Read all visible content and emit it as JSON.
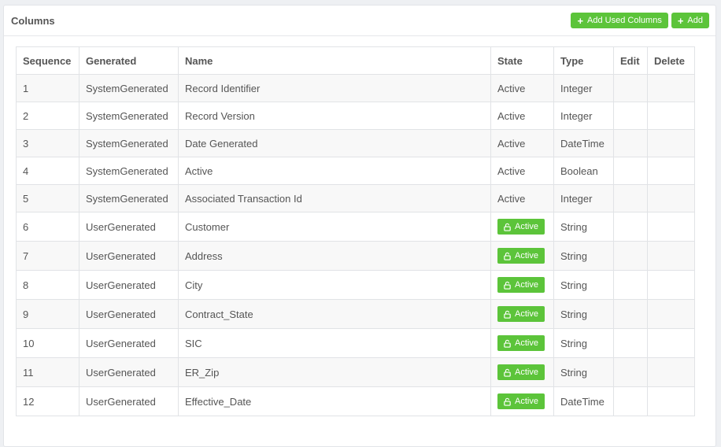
{
  "panel": {
    "title": "Columns",
    "add_used_columns_label": "Add Used Columns",
    "add_label": "Add"
  },
  "table": {
    "headers": [
      "Sequence",
      "Generated",
      "Name",
      "State",
      "Type",
      "Edit",
      "Delete"
    ],
    "rows": [
      {
        "seq": "1",
        "generated": "SystemGenerated",
        "name": "Record Identifier",
        "state": "Active",
        "badge": false,
        "type": "Integer"
      },
      {
        "seq": "2",
        "generated": "SystemGenerated",
        "name": "Record Version",
        "state": "Active",
        "badge": false,
        "type": "Integer"
      },
      {
        "seq": "3",
        "generated": "SystemGenerated",
        "name": "Date Generated",
        "state": "Active",
        "badge": false,
        "type": "DateTime"
      },
      {
        "seq": "4",
        "generated": "SystemGenerated",
        "name": "Active",
        "state": "Active",
        "badge": false,
        "type": "Boolean"
      },
      {
        "seq": "5",
        "generated": "SystemGenerated",
        "name": "Associated Transaction Id",
        "state": "Active",
        "badge": false,
        "type": "Integer"
      },
      {
        "seq": "6",
        "generated": "UserGenerated",
        "name": "Customer",
        "state": "Active",
        "badge": true,
        "type": "String"
      },
      {
        "seq": "7",
        "generated": "UserGenerated",
        "name": "Address",
        "state": "Active",
        "badge": true,
        "type": "String"
      },
      {
        "seq": "8",
        "generated": "UserGenerated",
        "name": "City",
        "state": "Active",
        "badge": true,
        "type": "String"
      },
      {
        "seq": "9",
        "generated": "UserGenerated",
        "name": "Contract_State",
        "state": "Active",
        "badge": true,
        "type": "String"
      },
      {
        "seq": "10",
        "generated": "UserGenerated",
        "name": "SIC",
        "state": "Active",
        "badge": true,
        "type": "String"
      },
      {
        "seq": "11",
        "generated": "UserGenerated",
        "name": "ER_Zip",
        "state": "Active",
        "badge": true,
        "type": "String"
      },
      {
        "seq": "12",
        "generated": "UserGenerated",
        "name": "Effective_Date",
        "state": "Active",
        "badge": true,
        "type": "DateTime"
      }
    ]
  },
  "colors": {
    "accent_green": "#5cc43a"
  },
  "icons": {
    "add": "plus-icon",
    "state_badge": "unlock-icon"
  }
}
